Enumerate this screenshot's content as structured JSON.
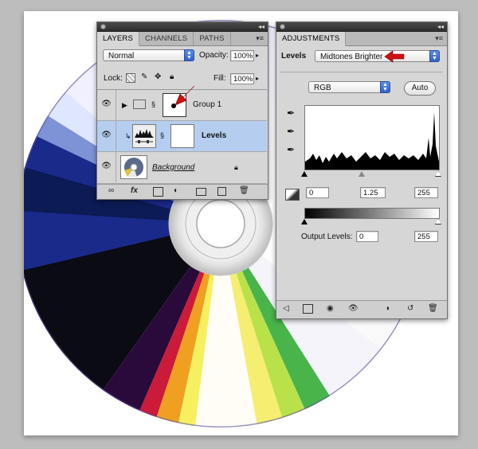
{
  "layers_panel": {
    "tabs": [
      "LAYERS",
      "CHANNELS",
      "PATHS"
    ],
    "blend_mode": "Normal",
    "opacity_label": "Opacity:",
    "opacity_value": "100%",
    "lock_label": "Lock:",
    "fill_label": "Fill:",
    "fill_value": "100%",
    "layers": [
      {
        "name": "Group 1"
      },
      {
        "name": "Levels"
      },
      {
        "name": "Background"
      }
    ],
    "footer_icons": [
      "link-icon",
      "fx-icon",
      "mask-icon",
      "adjustment-icon",
      "folder-icon",
      "new-layer-icon",
      "trash-icon"
    ]
  },
  "adjustments_panel": {
    "tab": "ADJUSTMENTS",
    "levels_label": "Levels",
    "preset_value": "Midtones Brighter",
    "channel_value": "RGB",
    "auto_label": "Auto",
    "input_black": "0",
    "input_mid": "1.25",
    "input_white": "255",
    "output_label": "Output Levels:",
    "output_black": "0",
    "output_white": "255",
    "accent_color": "#cc1111"
  }
}
